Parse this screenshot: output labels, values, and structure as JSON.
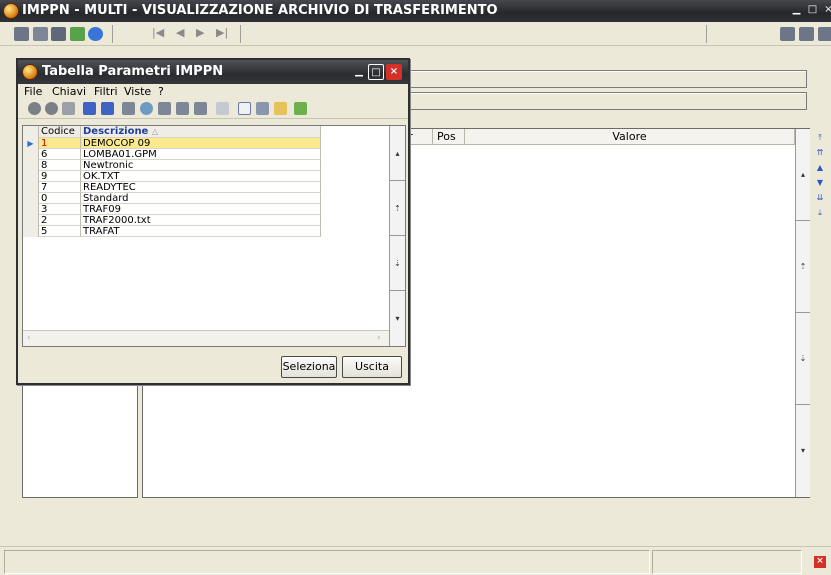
{
  "main_window": {
    "title": "IMPPN  - MULTI -  VISUALIZZAZIONE ARCHIVIO DI TRASFERIMENTO",
    "nav": [
      "|◀",
      "◀",
      "▶",
      "▶|"
    ]
  },
  "detail_table": {
    "columns": [
      "Err",
      "Pos",
      "Valore"
    ]
  },
  "dialog": {
    "title": "Tabella Parametri IMPPN",
    "menu": [
      "File",
      "Chiavi",
      "Filtri",
      "Viste",
      "?"
    ],
    "grid": {
      "headers": [
        "Codice",
        "Descrizione"
      ],
      "rows": [
        {
          "code": "1",
          "desc": "DEMOCOP 09"
        },
        {
          "code": "6",
          "desc": "LOMBA01.GPM"
        },
        {
          "code": "8",
          "desc": "Newtronic"
        },
        {
          "code": "9",
          "desc": "OK.TXT"
        },
        {
          "code": "7",
          "desc": "READYTEC"
        },
        {
          "code": "0",
          "desc": "Standard"
        },
        {
          "code": "3",
          "desc": "TRAF09"
        },
        {
          "code": "2",
          "desc": "TRAF2000.txt"
        },
        {
          "code": "5",
          "desc": "TRAFAT"
        }
      ],
      "selected_index": 0
    },
    "buttons": {
      "select": "Seleziona",
      "exit": "Uscita"
    }
  },
  "colors": {
    "titlebar": "#2b2c30",
    "selected_row": "#fbe98e",
    "close_red": "#d4302a",
    "header_blue": "#1f3f9c"
  }
}
